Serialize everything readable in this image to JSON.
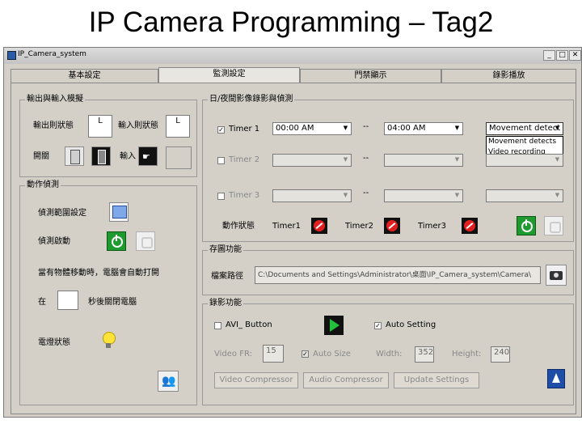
{
  "slide_title": "IP Camera Programming – Tag2",
  "window": {
    "title": "IP_Camera_system",
    "buttons": {
      "minimize": "_",
      "maximize": "□",
      "close": "✕"
    }
  },
  "tabs": [
    "基本設定",
    "監測設定",
    "門禁顯示",
    "錄影播放"
  ],
  "io_group": {
    "label": "輸出與輸入模擬",
    "output_status_label": "輸出則狀態",
    "output_status_value": "L",
    "input_status_label": "輸入則狀態",
    "input_status_value": "L",
    "switch_label": "開關",
    "input_label": "輸入"
  },
  "detect_group": {
    "label": "動作偵測",
    "area_label": "偵測範圍設定",
    "start_label": "偵測啟動",
    "notice": "當有物體移動時，電腦會自動打開",
    "within_label": "在",
    "seconds_label": "秒後關閉電腦",
    "light_label": "電燈狀態"
  },
  "timer_group": {
    "label": "日/夜間影像錄影與偵測",
    "timers": [
      {
        "label": "Timer 1",
        "checked": true,
        "start": "00:00  AM",
        "end": "04:00  AM",
        "action": "Movement detect"
      },
      {
        "label": "Timer 2",
        "checked": false,
        "start": "",
        "end": "",
        "action": ""
      },
      {
        "label": "Timer 3",
        "checked": false,
        "start": "",
        "end": "",
        "action": ""
      }
    ],
    "separator": "--",
    "dropdown_options": [
      "Movement detects",
      "Video recording"
    ],
    "status_label": "動作狀態",
    "status_items": [
      "Timer1",
      "Timer2",
      "Timer3"
    ]
  },
  "path_group": {
    "label": "存圖功能",
    "path_label": "檔案路徑",
    "path_value": "C:\\Documents and Settings\\Administrator\\桌面\\IP_Camera_system\\Camera\\"
  },
  "record_group": {
    "label": "錄影功能",
    "avi_label": "AVI_ Button",
    "auto_setting_label": "Auto Setting",
    "video_fr_label": "Video FR:",
    "video_fr_value": "15",
    "auto_size_label": "Auto Size",
    "width_label": "Width:",
    "width_value": "352",
    "height_label": "Height:",
    "height_value": "240",
    "buttons": [
      "Video Compressor",
      "Audio Compressor",
      "Update Settings"
    ]
  },
  "colors": {
    "window_bg": "#d4d0c8",
    "power_green": "#1f9a2f",
    "stop_red": "#e02020"
  }
}
